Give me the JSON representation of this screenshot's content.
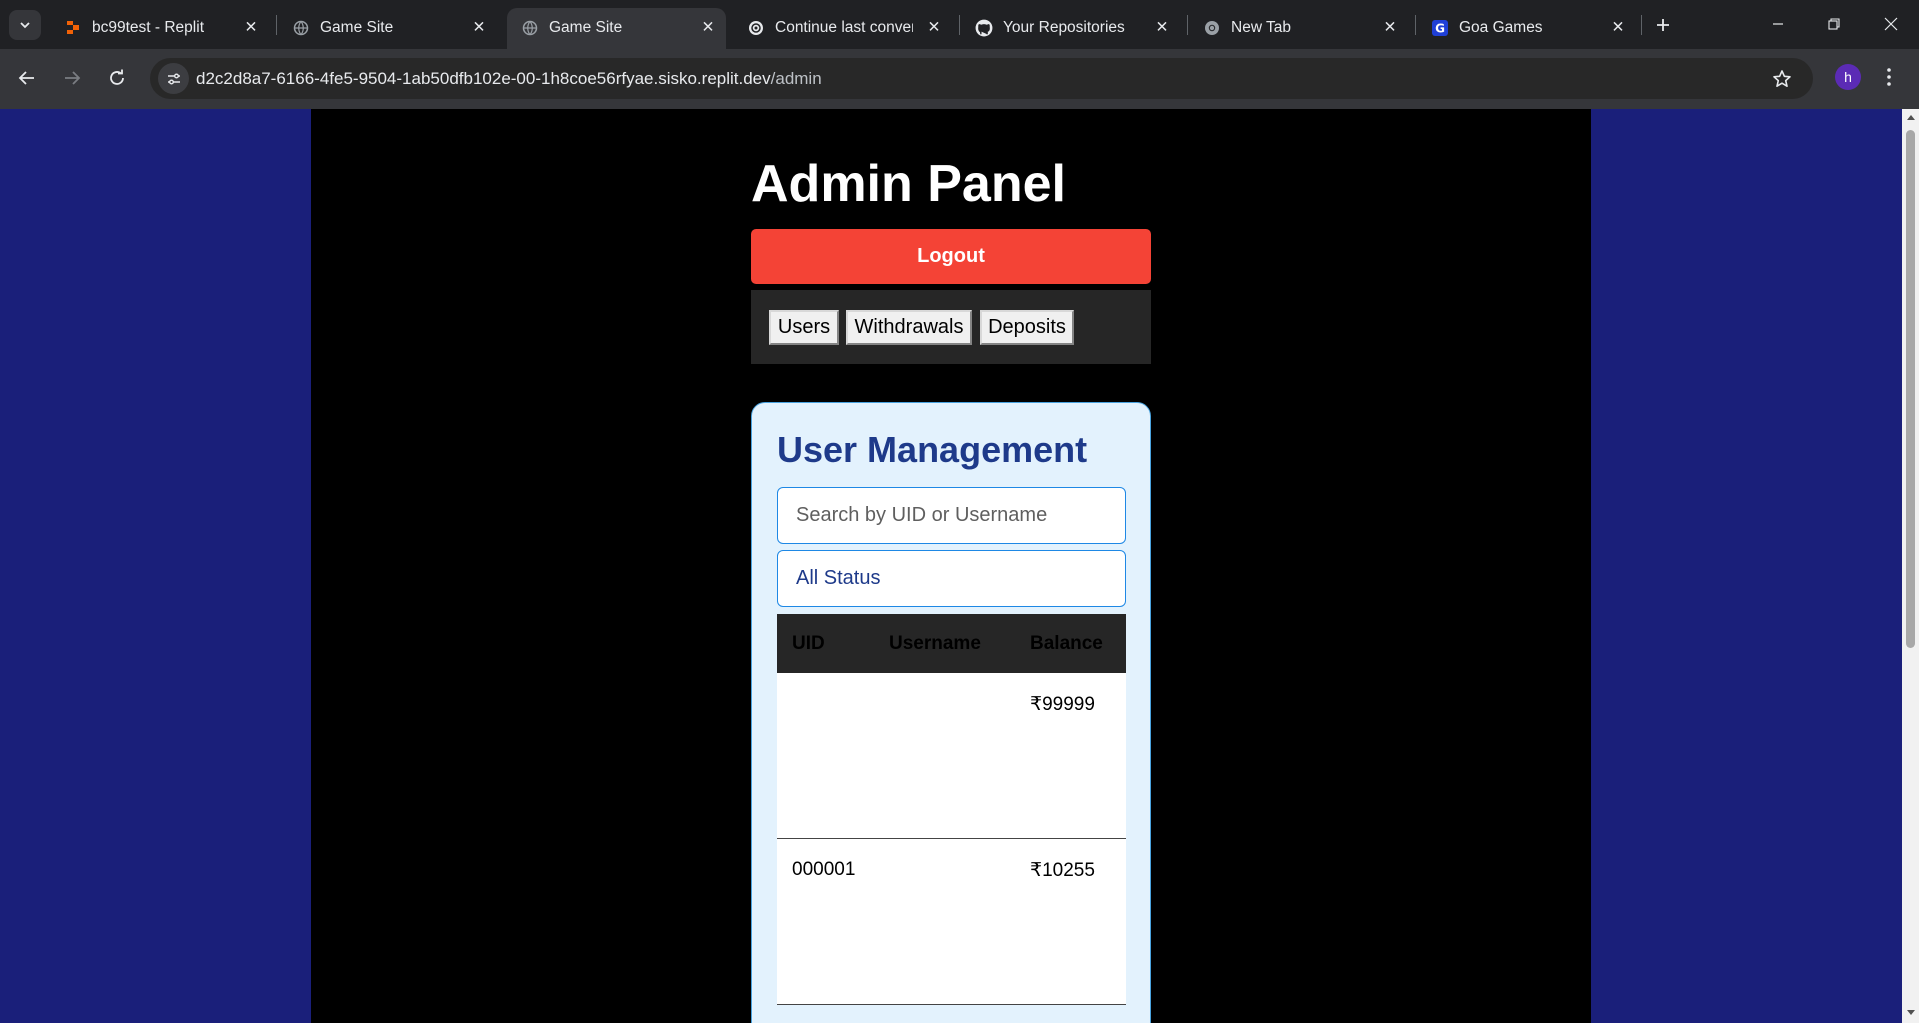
{
  "browser": {
    "tabs": [
      {
        "title": "bc99test - Replit",
        "icon": "replit-icon",
        "active": false
      },
      {
        "title": "Game Site",
        "icon": "globe-icon",
        "active": false
      },
      {
        "title": "Game Site",
        "icon": "globe-icon",
        "active": true
      },
      {
        "title": "Continue last conversation",
        "icon": "openai-icon",
        "active": false
      },
      {
        "title": "Your Repositories",
        "icon": "github-icon",
        "active": false
      },
      {
        "title": "New Tab",
        "icon": "chrome-icon",
        "active": false
      },
      {
        "title": "Goa Games",
        "icon": "goa-games-icon",
        "active": false
      }
    ],
    "url_host": "d2c2d8a7-6166-4fe5-9504-1ab50dfb102e-00-1h8coe56rfyae.sisko.replit.dev",
    "url_path": "/admin",
    "profile_initial": "h",
    "colors": {
      "tabbar": "#202124",
      "toolbar": "#35363a",
      "profile": "#5b2bb5"
    }
  },
  "page": {
    "title": "Admin Panel",
    "logout_label": "Logout",
    "nav": {
      "users": "Users",
      "withdrawals": "Withdrawals",
      "deposits": "Deposits"
    },
    "user_management": {
      "heading": "User Management",
      "search_placeholder": "Search by UID or Username",
      "status_filter": "All Status",
      "columns": {
        "uid": "UID",
        "username": "Username",
        "balance": "Balance"
      },
      "rows": [
        {
          "uid": "",
          "username": "",
          "balance": "₹99999"
        },
        {
          "uid": "000001",
          "username": "",
          "balance": "₹10255"
        }
      ]
    },
    "colors": {
      "background": "#1a1f7a",
      "main": "#000000",
      "logout": "#f44336",
      "panel": "#e3f2fd",
      "heading": "#1e3a8a"
    }
  }
}
